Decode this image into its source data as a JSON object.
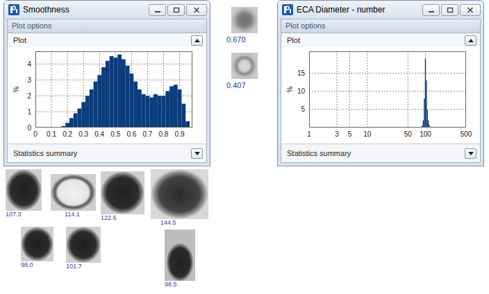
{
  "windows": [
    {
      "title": "Smoothness",
      "plot_options": "Plot options",
      "sections": [
        {
          "label": "Plot",
          "expanded": true
        },
        {
          "label": "Statistics summary",
          "expanded": false
        }
      ],
      "chart": {
        "kind": "linear",
        "y_label": "%",
        "y_ticks": [
          "0",
          "1",
          "2",
          "3",
          "4"
        ],
        "x_ticks": [
          "0",
          "0.1",
          "0.2",
          "0.3",
          "0.4",
          "0.5",
          "0.6",
          "0.7",
          "0.8",
          "0.9"
        ],
        "x_min": 0,
        "x_max": 0.98,
        "y_max": 4.8,
        "bin_edges": [
          0.1625,
          0.1875,
          0.2125,
          0.2375,
          0.2625,
          0.2875,
          0.3125,
          0.3375,
          0.3625,
          0.3875,
          0.4125,
          0.4375,
          0.4625,
          0.4875,
          0.5125,
          0.5375,
          0.5625,
          0.5875,
          0.6125,
          0.6375,
          0.6625,
          0.6875,
          0.7125,
          0.7375,
          0.7625,
          0.7875,
          0.8125,
          0.8375,
          0.8625,
          0.8875,
          0.9125,
          0.9375,
          0.9625
        ],
        "values": [
          0.1,
          0.3,
          0.6,
          0.9,
          1.2,
          1.6,
          2.0,
          2.4,
          2.9,
          3.3,
          3.8,
          4.2,
          4.5,
          4.4,
          4.6,
          4.3,
          3.9,
          3.4,
          2.9,
          2.4,
          2.1,
          2.0,
          1.9,
          2.1,
          2.0,
          2.0,
          2.3,
          2.6,
          2.7,
          2.4,
          1.5,
          0.4
        ]
      }
    },
    {
      "title": "ECA Diameter - number",
      "plot_options": "Plot options",
      "sections": [
        {
          "label": "Plot",
          "expanded": true
        },
        {
          "label": "Statistics summary",
          "expanded": false
        }
      ],
      "chart": {
        "kind": "log",
        "y_label": "%",
        "y_ticks": [
          "5",
          "10",
          "15"
        ],
        "x_ticks": [
          "1",
          "3",
          "5",
          "10",
          "50",
          "100",
          "500"
        ],
        "x_min": 1,
        "x_max": 500,
        "y_max": 21,
        "bin_edges": [
          86,
          90,
          94,
          98,
          102,
          106,
          110,
          114,
          118,
          122
        ],
        "values": [
          0.5,
          2,
          8,
          19,
          13,
          5,
          2,
          0.8,
          0.3
        ]
      }
    }
  ],
  "thumbnails": [
    {
      "label": "0.670"
    },
    {
      "label": "0.407"
    }
  ],
  "gallery": [
    [
      {
        "label": "107.3"
      },
      {
        "label": "114.1"
      },
      {
        "label": "122.6"
      },
      {
        "label": "144.5"
      }
    ],
    [
      {
        "label": "98.0"
      },
      {
        "label": "101.7"
      },
      {
        "label": "98.5"
      }
    ]
  ]
}
